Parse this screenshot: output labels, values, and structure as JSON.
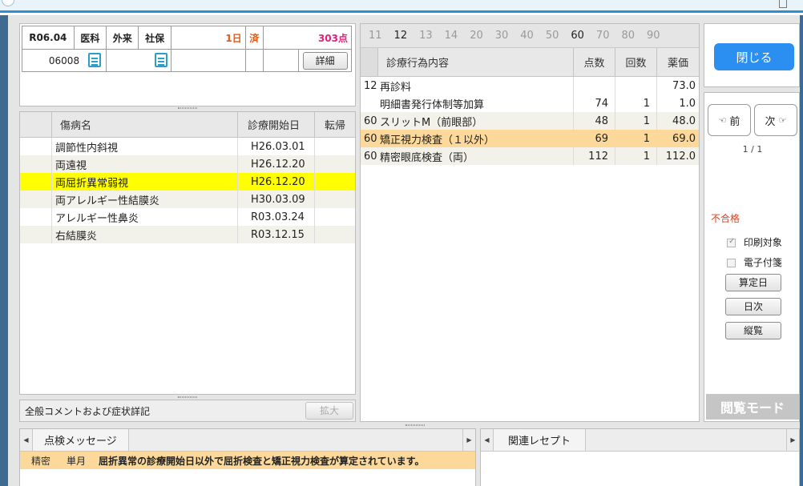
{
  "header": {
    "date": "R06.04",
    "dept": "医科",
    "visit_type": "外来",
    "insurance": "社保",
    "days": "1日",
    "status": "済",
    "points": "303点",
    "patient_id": "06008",
    "detail_label": "詳細"
  },
  "diseases": {
    "columns": [
      "傷病名",
      "診療開始日",
      "転帰"
    ],
    "rows": [
      {
        "name": "調節性内斜視",
        "start": "H26.03.01",
        "outcome": ""
      },
      {
        "name": "両遠視",
        "start": "H26.12.20",
        "outcome": ""
      },
      {
        "name": "両屈折異常弱視",
        "start": "H26.12.20",
        "outcome": ""
      },
      {
        "name": "両アレルギー性結膜炎",
        "start": "H30.03.09",
        "outcome": ""
      },
      {
        "name": "アレルギー性鼻炎",
        "start": "R03.03.24",
        "outcome": ""
      },
      {
        "name": "右結膜炎",
        "start": "R03.12.15",
        "outcome": ""
      }
    ],
    "selected_index": 2
  },
  "comment": {
    "label": "全般コメントおよび症状詳記",
    "expand_label": "拡大"
  },
  "treatments": {
    "tabs": [
      "11",
      "12",
      "13",
      "14",
      "20",
      "30",
      "40",
      "50",
      "60",
      "70",
      "80",
      "90"
    ],
    "active_tabs": [
      "12",
      "60"
    ],
    "columns": [
      "診療行為内容",
      "点数",
      "回数",
      "薬価"
    ],
    "rows": [
      {
        "code": "12",
        "content": "再診料",
        "points": "",
        "count": "",
        "price": "73.0"
      },
      {
        "code": "",
        "content": "明細書発行体制等加算",
        "points": "74",
        "count": "1",
        "price": "1.0"
      },
      {
        "code": "60",
        "content": "スリットM（前眼部）",
        "points": "48",
        "count": "1",
        "price": "48.0"
      },
      {
        "code": "60",
        "content": "矯正視力検査（１以外）",
        "points": "69",
        "count": "1",
        "price": "69.0"
      },
      {
        "code": "60",
        "content": "精密眼底検査（両）",
        "points": "112",
        "count": "1",
        "price": "112.0"
      }
    ],
    "selected_index": 3
  },
  "sidebar": {
    "close_label": "閉じる",
    "prev_label": "前",
    "next_label": "次",
    "page_indicator": "1 / 1",
    "fail_label": "不合格",
    "print_target_label": "印刷対象",
    "print_target_checked": true,
    "e_sticky_label": "電子付箋",
    "e_sticky_checked": false,
    "calc_date_label": "算定日",
    "daily_label": "日次",
    "browse_label": "縦覧",
    "mode_label": "閲覧モード"
  },
  "bottom": {
    "check_tab": "点検メッセージ",
    "related_tab": "関連レセプト",
    "messages": [
      {
        "level": "精密",
        "period": "単月",
        "text": "屈折異常の診療開始日以外で屈折検査と矯正視力検査が算定されています。"
      }
    ]
  },
  "colors": {
    "accent_blue": "#2a8ff0",
    "selected_yellow": "#ffff00",
    "selected_orange": "#fcd99a",
    "status_orange": "#e45a14",
    "points_pink": "#e0207a",
    "fail_red": "#e04020"
  }
}
